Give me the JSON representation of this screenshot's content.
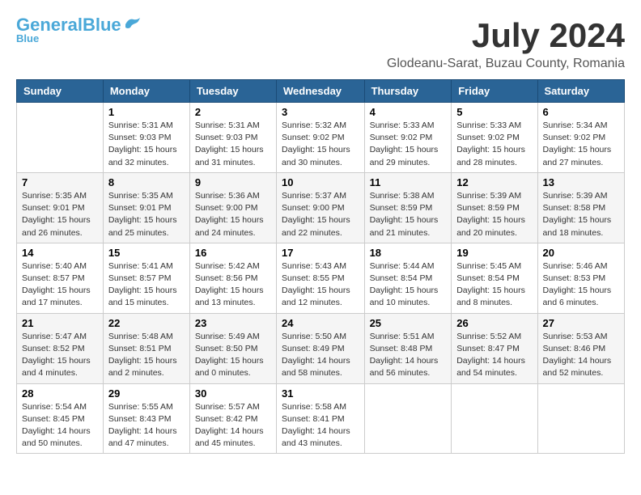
{
  "header": {
    "logo_main": "General",
    "logo_accent": "Blue",
    "month_title": "July 2024",
    "location": "Glodeanu-Sarat, Buzau County, Romania"
  },
  "days_of_week": [
    "Sunday",
    "Monday",
    "Tuesday",
    "Wednesday",
    "Thursday",
    "Friday",
    "Saturday"
  ],
  "weeks": [
    [
      {
        "day": "",
        "info": ""
      },
      {
        "day": "1",
        "info": "Sunrise: 5:31 AM\nSunset: 9:03 PM\nDaylight: 15 hours\nand 32 minutes."
      },
      {
        "day": "2",
        "info": "Sunrise: 5:31 AM\nSunset: 9:03 PM\nDaylight: 15 hours\nand 31 minutes."
      },
      {
        "day": "3",
        "info": "Sunrise: 5:32 AM\nSunset: 9:02 PM\nDaylight: 15 hours\nand 30 minutes."
      },
      {
        "day": "4",
        "info": "Sunrise: 5:33 AM\nSunset: 9:02 PM\nDaylight: 15 hours\nand 29 minutes."
      },
      {
        "day": "5",
        "info": "Sunrise: 5:33 AM\nSunset: 9:02 PM\nDaylight: 15 hours\nand 28 minutes."
      },
      {
        "day": "6",
        "info": "Sunrise: 5:34 AM\nSunset: 9:02 PM\nDaylight: 15 hours\nand 27 minutes."
      }
    ],
    [
      {
        "day": "7",
        "info": "Sunrise: 5:35 AM\nSunset: 9:01 PM\nDaylight: 15 hours\nand 26 minutes."
      },
      {
        "day": "8",
        "info": "Sunrise: 5:35 AM\nSunset: 9:01 PM\nDaylight: 15 hours\nand 25 minutes."
      },
      {
        "day": "9",
        "info": "Sunrise: 5:36 AM\nSunset: 9:00 PM\nDaylight: 15 hours\nand 24 minutes."
      },
      {
        "day": "10",
        "info": "Sunrise: 5:37 AM\nSunset: 9:00 PM\nDaylight: 15 hours\nand 22 minutes."
      },
      {
        "day": "11",
        "info": "Sunrise: 5:38 AM\nSunset: 8:59 PM\nDaylight: 15 hours\nand 21 minutes."
      },
      {
        "day": "12",
        "info": "Sunrise: 5:39 AM\nSunset: 8:59 PM\nDaylight: 15 hours\nand 20 minutes."
      },
      {
        "day": "13",
        "info": "Sunrise: 5:39 AM\nSunset: 8:58 PM\nDaylight: 15 hours\nand 18 minutes."
      }
    ],
    [
      {
        "day": "14",
        "info": "Sunrise: 5:40 AM\nSunset: 8:57 PM\nDaylight: 15 hours\nand 17 minutes."
      },
      {
        "day": "15",
        "info": "Sunrise: 5:41 AM\nSunset: 8:57 PM\nDaylight: 15 hours\nand 15 minutes."
      },
      {
        "day": "16",
        "info": "Sunrise: 5:42 AM\nSunset: 8:56 PM\nDaylight: 15 hours\nand 13 minutes."
      },
      {
        "day": "17",
        "info": "Sunrise: 5:43 AM\nSunset: 8:55 PM\nDaylight: 15 hours\nand 12 minutes."
      },
      {
        "day": "18",
        "info": "Sunrise: 5:44 AM\nSunset: 8:54 PM\nDaylight: 15 hours\nand 10 minutes."
      },
      {
        "day": "19",
        "info": "Sunrise: 5:45 AM\nSunset: 8:54 PM\nDaylight: 15 hours\nand 8 minutes."
      },
      {
        "day": "20",
        "info": "Sunrise: 5:46 AM\nSunset: 8:53 PM\nDaylight: 15 hours\nand 6 minutes."
      }
    ],
    [
      {
        "day": "21",
        "info": "Sunrise: 5:47 AM\nSunset: 8:52 PM\nDaylight: 15 hours\nand 4 minutes."
      },
      {
        "day": "22",
        "info": "Sunrise: 5:48 AM\nSunset: 8:51 PM\nDaylight: 15 hours\nand 2 minutes."
      },
      {
        "day": "23",
        "info": "Sunrise: 5:49 AM\nSunset: 8:50 PM\nDaylight: 15 hours\nand 0 minutes."
      },
      {
        "day": "24",
        "info": "Sunrise: 5:50 AM\nSunset: 8:49 PM\nDaylight: 14 hours\nand 58 minutes."
      },
      {
        "day": "25",
        "info": "Sunrise: 5:51 AM\nSunset: 8:48 PM\nDaylight: 14 hours\nand 56 minutes."
      },
      {
        "day": "26",
        "info": "Sunrise: 5:52 AM\nSunset: 8:47 PM\nDaylight: 14 hours\nand 54 minutes."
      },
      {
        "day": "27",
        "info": "Sunrise: 5:53 AM\nSunset: 8:46 PM\nDaylight: 14 hours\nand 52 minutes."
      }
    ],
    [
      {
        "day": "28",
        "info": "Sunrise: 5:54 AM\nSunset: 8:45 PM\nDaylight: 14 hours\nand 50 minutes."
      },
      {
        "day": "29",
        "info": "Sunrise: 5:55 AM\nSunset: 8:43 PM\nDaylight: 14 hours\nand 47 minutes."
      },
      {
        "day": "30",
        "info": "Sunrise: 5:57 AM\nSunset: 8:42 PM\nDaylight: 14 hours\nand 45 minutes."
      },
      {
        "day": "31",
        "info": "Sunrise: 5:58 AM\nSunset: 8:41 PM\nDaylight: 14 hours\nand 43 minutes."
      },
      {
        "day": "",
        "info": ""
      },
      {
        "day": "",
        "info": ""
      },
      {
        "day": "",
        "info": ""
      }
    ]
  ]
}
